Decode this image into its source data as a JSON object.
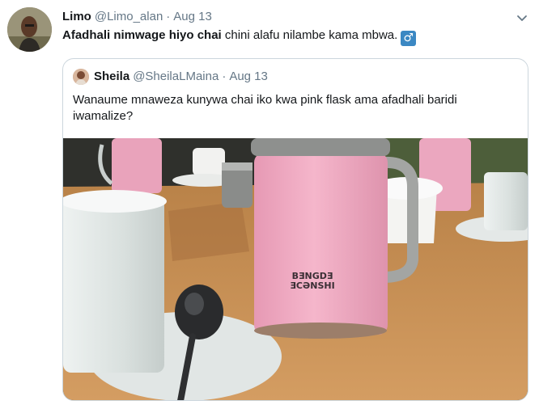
{
  "tweet": {
    "author_name": "Limo",
    "author_handle": "@Limo_alan",
    "separator": "·",
    "date": "Aug 13",
    "text_bold": "Afadhali nimwage hiyo chai",
    "text_rest": " chini alafu nilambe kama mbwa.",
    "emoji": "♂",
    "menu_icon": "chevron-down-icon"
  },
  "quoted": {
    "author_name": "Sheila",
    "author_handle": "@SheilaLMaina",
    "separator": "·",
    "date": "Aug 13",
    "text": "Wanaume mnaweza kunywa chai iko kwa pink flask ama afadhali baridi iwamalize?"
  },
  "photo": {
    "flask_print_line1": "BƎNGDƎ",
    "flask_print_line2": "ƎCƏNSHI"
  },
  "colors": {
    "link_gray": "#657786",
    "border": "#ccd6dd",
    "flask_pink": "#f0a8c0",
    "table_wood": "#c98f52",
    "emoji_blue": "#3b88c3"
  }
}
